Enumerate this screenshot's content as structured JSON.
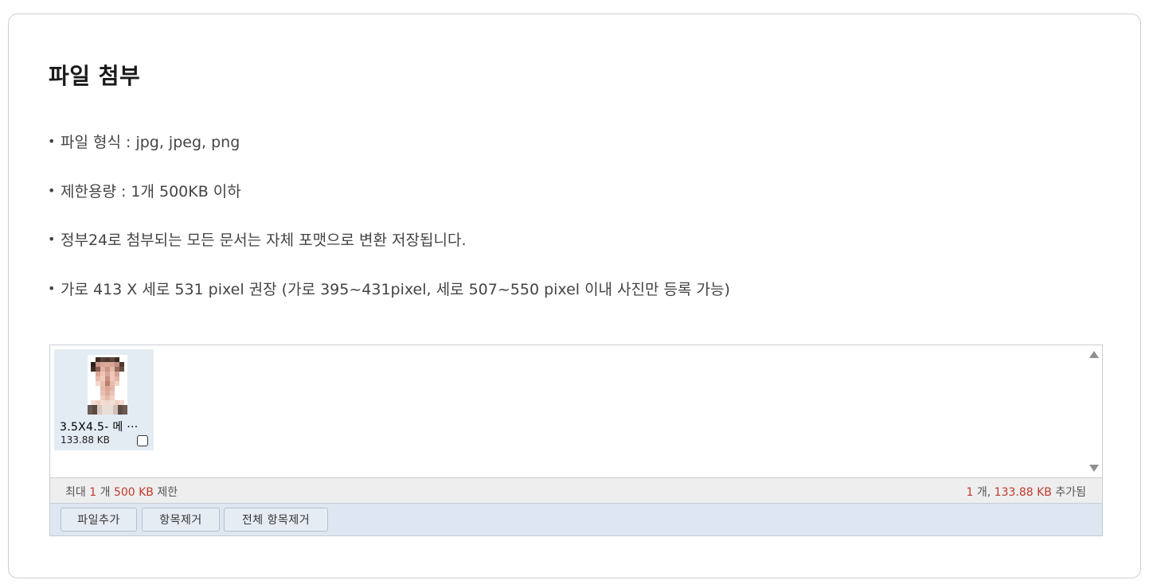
{
  "section": {
    "title": "파일 첨부"
  },
  "notes": [
    {
      "bullet": "•",
      "text": "파일 형식 : jpg, jpeg, png"
    },
    {
      "bullet": "•",
      "text": "제한용량 : 1개 500KB 이하"
    },
    {
      "bullet": "•",
      "text": "정부24로 첨부되는 모든 문서는 자체 포맷으로 변환 저장됩니다."
    },
    {
      "bullet": "•",
      "text": "가로 413 X 세로 531 pixel 권장 (가로 395~431pixel, 세로 507~550 pixel 이내 사진만 등록 가능)"
    }
  ],
  "uploader": {
    "files": [
      {
        "name": "3.5X4.5- 메 ···",
        "size": "133.88 KB",
        "checked": false,
        "thumbnail": "pixelated portrait photo"
      }
    ],
    "status": {
      "limit_prefix": "최대",
      "limit_count": "1",
      "limit_count_unit": "개",
      "limit_size": "500 KB",
      "limit_suffix": "제한",
      "added_count": "1",
      "added_count_unit": "개,",
      "added_size": "133.88 KB",
      "added_suffix": "추가됨"
    },
    "buttons": {
      "add": "파일추가",
      "remove": "항목제거",
      "remove_all": "전체 항목제거"
    },
    "scroll_icons": [
      "scroll-up-arrow-icon",
      "scroll-down-arrow-icon"
    ]
  },
  "colors": {
    "highlight": "#c0392b",
    "button_bar": "#dee6f1",
    "file_item_bg": "#e3ebf3",
    "status_bar": "#eeeeee"
  }
}
